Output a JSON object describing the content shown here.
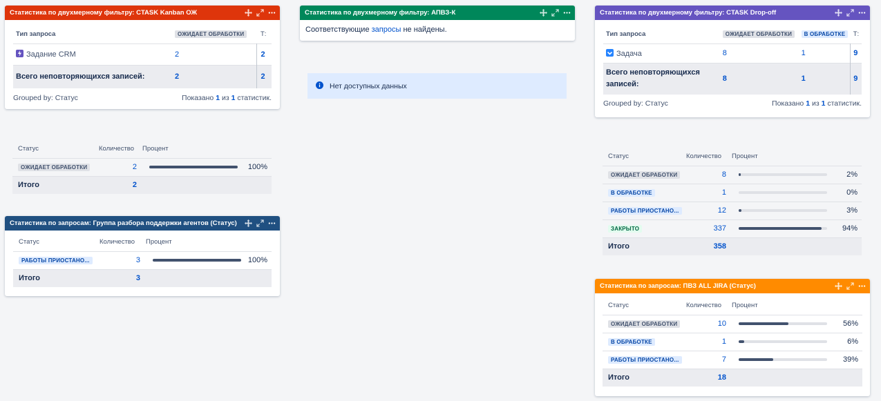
{
  "gadget1": {
    "title": "Статистика по двухмерному фильтру: CTASK Kanban ОЖ",
    "color": "#de350b",
    "col_type": "Тип запроса",
    "col_status": "ОЖИДАЕТ ОБРАБОТКИ",
    "col_total": "Т:",
    "row_label": "Задание CRM",
    "row_value": "2",
    "row_total": "2",
    "sum_label": "Всего неповторяющихся записей:",
    "sum_value": "2",
    "sum_total": "2",
    "grouped": "Grouped by: Статус",
    "shown_prefix": "Показано",
    "shown_a": "1",
    "shown_mid": "из",
    "shown_b": "1",
    "shown_suffix": "статистик."
  },
  "gadget2": {
    "title": "Статистика по двухмерному фильтру: АПВЗ-К",
    "color": "#00875a",
    "msg_a": "Соответствующие",
    "msg_link": "запросы",
    "msg_b": "не найдены."
  },
  "info": {
    "text": "Нет доступных данных"
  },
  "gadget3": {
    "title": "Статистика по двухмерному фильтру: CTASK Drop-off",
    "color": "#6554c0",
    "col_type": "Тип запроса",
    "col_s1": "ОЖИДАЕТ ОБРАБОТКИ",
    "col_s2": "В ОБРАБОТКЕ",
    "col_total": "Т:",
    "row_label": "Задача",
    "row_v1": "8",
    "row_v2": "1",
    "row_total": "9",
    "sum_label": "Всего неповторяющихся записей:",
    "sum_v1": "8",
    "sum_v2": "1",
    "sum_total": "9",
    "grouped": "Grouped by: Статус",
    "shown_prefix": "Показано",
    "shown_a": "1",
    "shown_mid": "из",
    "shown_b": "1",
    "shown_suffix": "статистик."
  },
  "stat1": {
    "h_status": "Статус",
    "h_count": "Количество",
    "h_percent": "Процент",
    "rows": [
      {
        "status": "ОЖИДАЕТ ОБРАБОТКИ",
        "count": "2",
        "percent": "100%",
        "fill": 1.0
      }
    ],
    "total_label": "Итого",
    "total_value": "2"
  },
  "gadget4": {
    "title": "Статистика по запросам: Группа разбора поддержки агентов (Статус)",
    "color": "#205081",
    "h_status": "Статус",
    "h_count": "Количество",
    "h_percent": "Процент",
    "rows": [
      {
        "status": "РАБОТЫ ПРИОСТАНО...",
        "count": "3",
        "percent": "100%",
        "fill": 1.0
      }
    ],
    "total_label": "Итого",
    "total_value": "3"
  },
  "stat2": {
    "h_status": "Статус",
    "h_count": "Количество",
    "h_percent": "Процент",
    "rows": [
      {
        "status": "ОЖИДАЕТ ОБРАБОТКИ",
        "count": "8",
        "percent": "2%",
        "fill": 0.02
      },
      {
        "status": "В ОБРАБОТКЕ",
        "count": "1",
        "percent": "0%",
        "fill": 0.0
      },
      {
        "status": "РАБОТЫ ПРИОСТАНО...",
        "count": "12",
        "percent": "3%",
        "fill": 0.03
      },
      {
        "status": "ЗАКРЫТО",
        "count": "337",
        "percent": "94%",
        "fill": 0.94
      }
    ],
    "total_label": "Итого",
    "total_value": "358"
  },
  "gadget5": {
    "title": "Статистика по запросам: ПВЗ ALL JIRA (Статус)",
    "color": "#ff8b00",
    "h_status": "Статус",
    "h_count": "Количество",
    "h_percent": "Процент",
    "rows": [
      {
        "status": "ОЖИДАЕТ ОБРАБОТКИ",
        "count": "10",
        "percent": "56%",
        "fill": 0.56
      },
      {
        "status": "В ОБРАБОТКЕ",
        "count": "1",
        "percent": "6%",
        "fill": 0.06
      },
      {
        "status": "РАБОТЫ ПРИОСТАНО...",
        "count": "7",
        "percent": "39%",
        "fill": 0.39
      }
    ],
    "total_label": "Итого",
    "total_value": "18"
  },
  "icons": {
    "move": "move-icon",
    "expand": "expand-icon",
    "menu": "more-icon",
    "info": "info-icon",
    "crm": "crm-task-icon",
    "task": "task-icon"
  }
}
